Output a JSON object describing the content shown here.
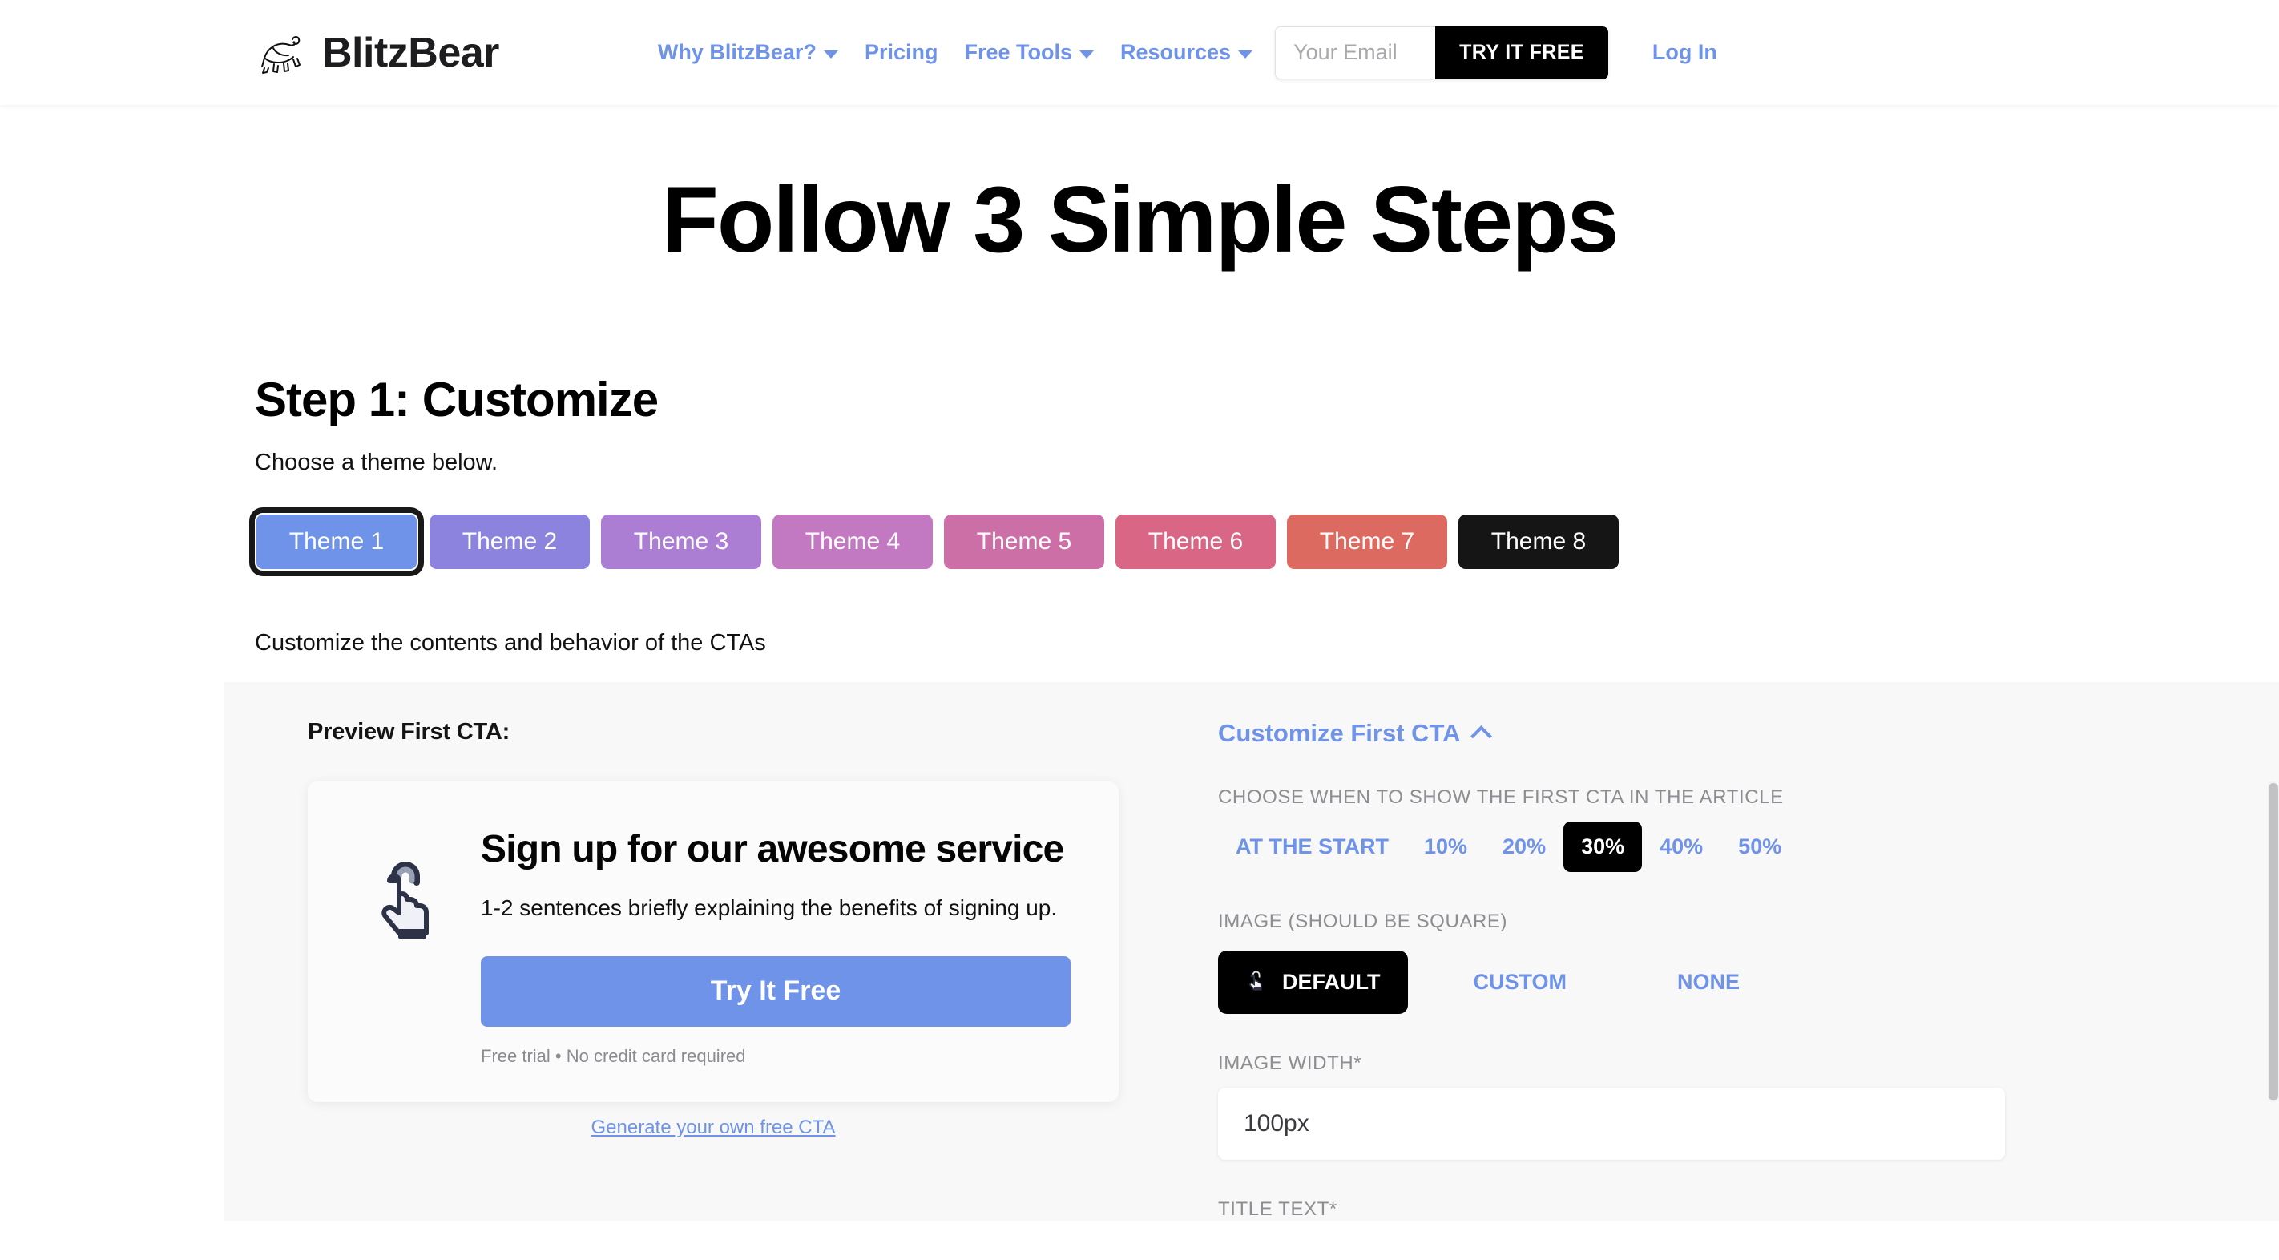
{
  "nav": {
    "brand": "BlitzBear",
    "logo_icon": "bear-logo-icon",
    "links": [
      {
        "label": "Why BlitzBear?",
        "caret": true
      },
      {
        "label": "Pricing",
        "caret": false
      },
      {
        "label": "Free Tools",
        "caret": true
      },
      {
        "label": "Resources",
        "caret": true
      }
    ],
    "email_placeholder": "Your Email",
    "email_value": "",
    "try_free_label": "TRY IT FREE",
    "login_label": "Log In"
  },
  "hero": {
    "title": "Follow 3 Simple Steps"
  },
  "step": {
    "title": "Step 1: Customize",
    "subtitle": "Choose a theme below.",
    "customize_note": "Customize the contents and behavior of the CTAs"
  },
  "themes": [
    {
      "label": "Theme 1",
      "color": "#6e93e8",
      "selected": true
    },
    {
      "label": "Theme 2",
      "color": "#8b83de",
      "selected": false
    },
    {
      "label": "Theme 3",
      "color": "#ab7dd3",
      "selected": false
    },
    {
      "label": "Theme 4",
      "color": "#c379c2",
      "selected": false
    },
    {
      "label": "Theme 5",
      "color": "#cb6fa6",
      "selected": false
    },
    {
      "label": "Theme 6",
      "color": "#da6686",
      "selected": false
    },
    {
      "label": "Theme 7",
      "color": "#dd6a61",
      "selected": false
    },
    {
      "label": "Theme 8",
      "color": "#151515",
      "selected": false
    }
  ],
  "preview": {
    "label": "Preview First CTA:",
    "cta_icon": "pointing-hand-icon",
    "cta_title": "Sign up for our awesome service",
    "cta_desc": "1-2 sentences briefly explaining the benefits of signing up.",
    "cta_button": "Try It Free",
    "cta_footnote": "Free trial • No credit card required",
    "generate_link": "Generate your own free CTA"
  },
  "customize": {
    "header": "Customize First CTA",
    "header_chevron": "chevron-up-icon",
    "when_label": "CHOOSE WHEN TO SHOW THE FIRST CTA IN THE ARTICLE",
    "when_options": [
      {
        "label": "AT THE START",
        "active": false
      },
      {
        "label": "10%",
        "active": false
      },
      {
        "label": "20%",
        "active": false
      },
      {
        "label": "30%",
        "active": true
      },
      {
        "label": "40%",
        "active": false
      },
      {
        "label": "50%",
        "active": false
      }
    ],
    "image_label": "IMAGE (SHOULD BE SQUARE)",
    "image_options": [
      {
        "label": "DEFAULT",
        "active": true,
        "icon": "pointing-hand-icon"
      },
      {
        "label": "CUSTOM",
        "active": false,
        "icon": ""
      },
      {
        "label": "NONE",
        "active": false,
        "icon": ""
      }
    ],
    "image_width_label": "IMAGE WIDTH*",
    "image_width_value": "100px",
    "image_width_placeholder": "100px",
    "title_text_label": "TITLE TEXT*"
  },
  "colors": {
    "accent_blue": "#6e93e8",
    "black": "#000000",
    "panel_bg": "#f8f8f9",
    "muted_gray": "#8d8d92"
  }
}
